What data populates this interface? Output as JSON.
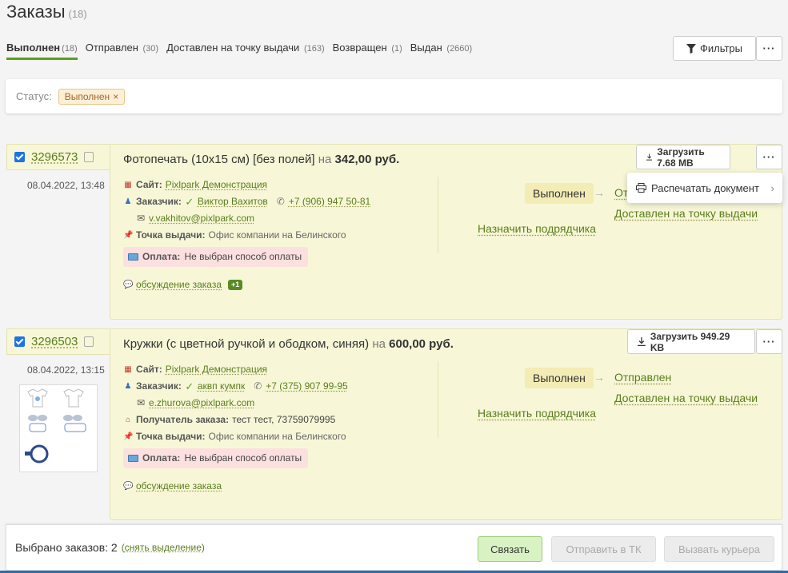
{
  "header": {
    "title": "Заказы",
    "count": "(18)"
  },
  "tabs": [
    {
      "label": "Выполнен",
      "count": "(18)"
    },
    {
      "label": "Отправлен",
      "count": "(30)"
    },
    {
      "label": "Доставлен на точку выдачи",
      "count": "(163)"
    },
    {
      "label": "Возвращен",
      "count": "(1)"
    },
    {
      "label": "Выдан",
      "count": "(2660)"
    }
  ],
  "toolbar": {
    "filters_label": "Фильтры",
    "more_label": "···"
  },
  "status_filter": {
    "label": "Статус:",
    "chip": "Выполнен",
    "chip_close": "×"
  },
  "dropdown": {
    "item_label": "Распечатать документ",
    "chevron": "›"
  },
  "orders": [
    {
      "id": "3296573",
      "date": "08.04.2022, 13:48",
      "title": "Фотопечать (10x15 см) [без полей]",
      "on": "на",
      "price": "342,00 руб.",
      "download_label": "Загрузить 7.68 MB",
      "site_label": "Сайт:",
      "site": "Pixlpark Демонстрация",
      "customer_label": "Заказчик:",
      "customer": "Виктор Вахитов",
      "phone": "+7 (906) 947 50-81",
      "email": "v.vakhitov@pixlpark.com",
      "pickup_label": "Точка выдачи:",
      "pickup": "Офис компании на Белинского",
      "payment_label": "Оплата:",
      "payment": "Не выбран способ оплаты",
      "discussion": "обсуждение заказа",
      "discussion_badge": "+1",
      "status": "Выполнен",
      "next_status_1": "Отправлен",
      "next_status_2": "Доставлен на точку выдачи",
      "assign": "Назначить подрядчика"
    },
    {
      "id": "3296503",
      "date": "08.04.2022, 13:15",
      "title": "Кружки (с цветной ручкой и ободком, синяя)",
      "on": "на",
      "price": "600,00 руб.",
      "download_label": "Загрузить 949.29 KB",
      "site_label": "Сайт:",
      "site": "Pixlpark Демонстрация",
      "customer_label": "Заказчик:",
      "customer": "аквп кумпк",
      "phone": "+7 (375) 907 99-95",
      "email": "e.zhurova@pixlpark.com",
      "recipient_label": "Получатель заказа:",
      "recipient": "тест тест, 73759079995",
      "pickup_label": "Точка выдачи:",
      "pickup": "Офис компании на Белинского",
      "payment_label": "Оплата:",
      "payment": "Не выбран способ оплаты",
      "discussion": "обсуждение заказа",
      "status": "Выполнен",
      "next_status_1": "Отправлен",
      "next_status_2": "Доставлен на точку выдачи",
      "assign": "Назначить подрядчика"
    }
  ],
  "bottom": {
    "selected_text": "Выбрано заказов: 2",
    "clear_open": "(",
    "clear_label": "снять выделение",
    "clear_close": ")",
    "link_btn": "Связать",
    "tk_btn": "Отправить в ТК",
    "courier_btn": "Вызвать курьера"
  },
  "colors": {
    "accent": "#5a9f1e",
    "card_bg": "#f7f7d7",
    "link": "#5a7d1c",
    "payment_bg": "#fce0e0"
  }
}
